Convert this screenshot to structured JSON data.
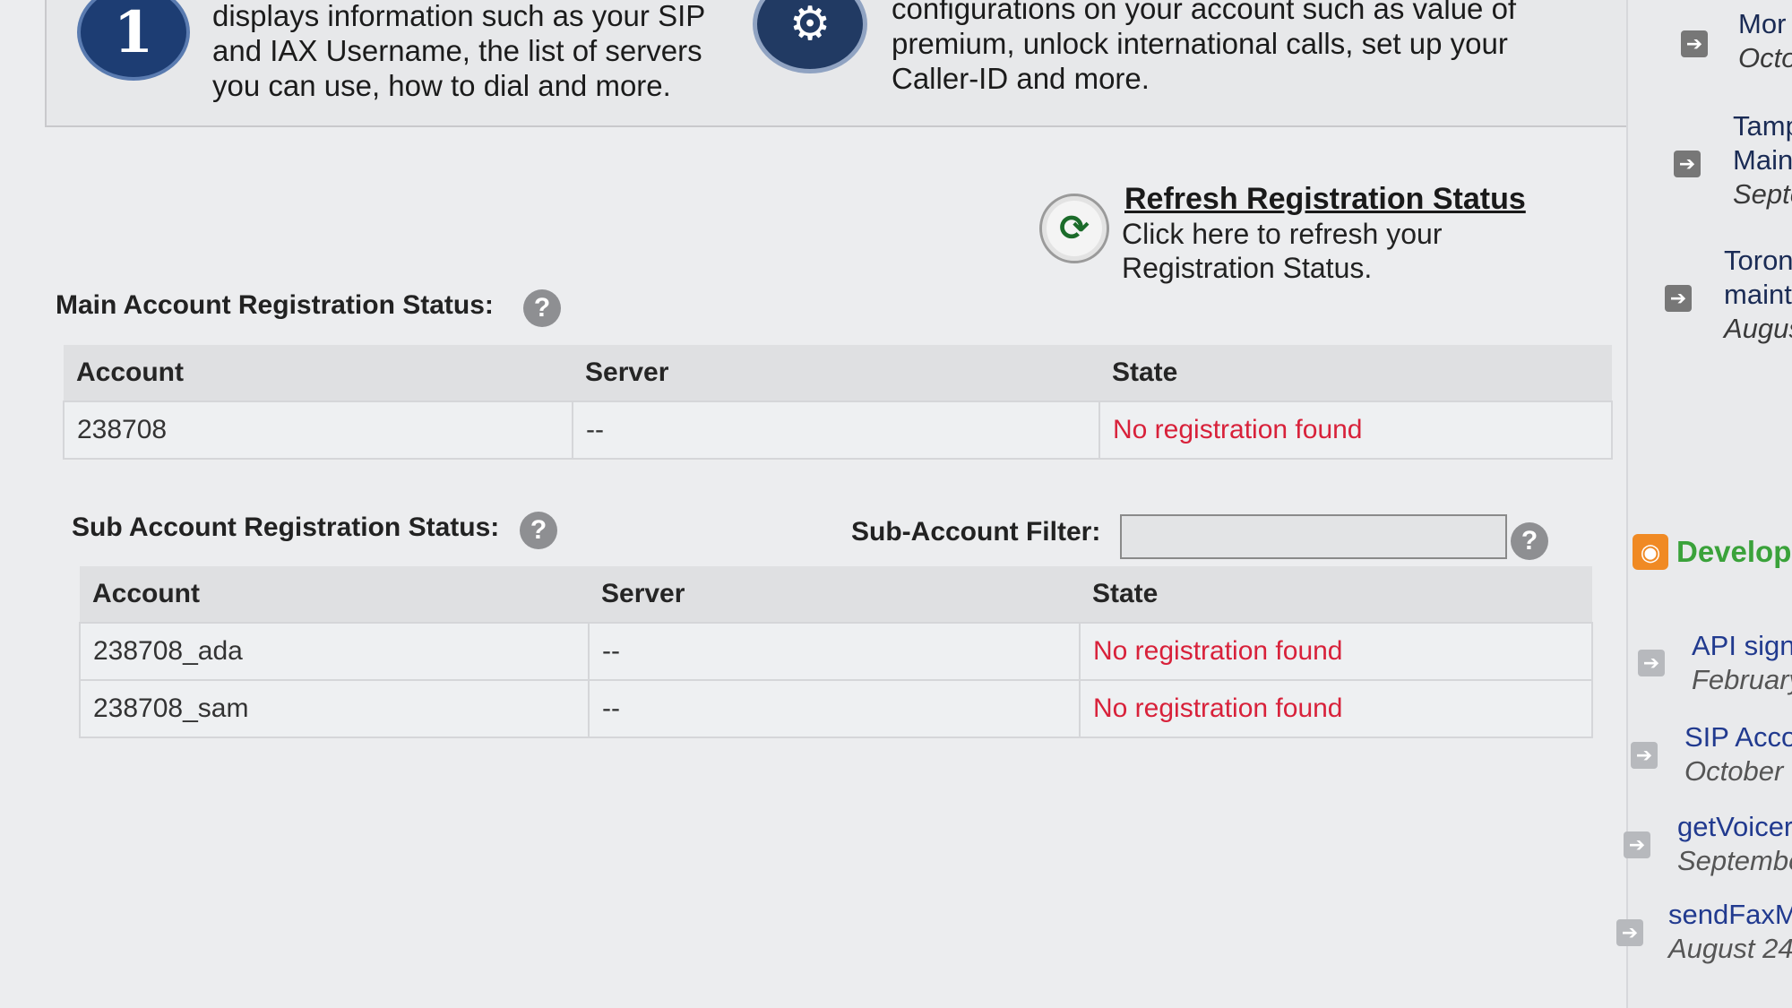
{
  "info_panel": {
    "badge_number": "1",
    "left_text": [
      "displays information such as your SIP",
      "and IAX Username, the list of servers",
      "you can use, how to dial and more."
    ],
    "right_text": [
      "configurations on your account such as value of",
      "premium, unlock international calls, set up your",
      "Caller-ID and more."
    ]
  },
  "refresh": {
    "title": "Refresh Registration Status",
    "desc": [
      "Click here to refresh your",
      "Registration Status."
    ]
  },
  "main_status": {
    "label": "Main Account Registration Status:",
    "help": "?",
    "columns": [
      "Account",
      "Server",
      "State"
    ],
    "rows": [
      {
        "account": "238708",
        "server": "--",
        "state": "No registration found"
      }
    ]
  },
  "sub_status": {
    "label": "Sub Account Registration Status:",
    "help": "?",
    "filter_label": "Sub-Account Filter:",
    "filter_value": "",
    "filter_help": "?",
    "columns": [
      "Account",
      "Server",
      "State"
    ],
    "rows": [
      {
        "account": "238708_ada",
        "server": "--",
        "state": "No registration found"
      },
      {
        "account": "238708_sam",
        "server": "--",
        "state": "No registration found"
      }
    ]
  },
  "sidebar": {
    "news": [
      {
        "title": "Mor",
        "date": "Octo"
      },
      {
        "title1": "Tamp",
        "title2": "Main",
        "date": "Septe"
      },
      {
        "title1": "Toron",
        "title2": "maint",
        "date": "Augus"
      }
    ],
    "developer_title": "Develop",
    "api": [
      {
        "title": "API sign",
        "date": "February"
      },
      {
        "title": "SIP Acco",
        "date": "October :"
      },
      {
        "title": "getVoicer",
        "date": "Septembe"
      },
      {
        "title": "sendFaxM",
        "date": "August 24"
      }
    ]
  },
  "colors": {
    "state_red": "#d8213a",
    "link_blue": "#213a8f",
    "dev_green": "#3aa23a",
    "badge_navy": "#1d3d73"
  },
  "icons": [
    "info-number-icon",
    "gear-icon",
    "refresh-icon",
    "help-icon",
    "arrow-right-icon",
    "rss-icon"
  ]
}
